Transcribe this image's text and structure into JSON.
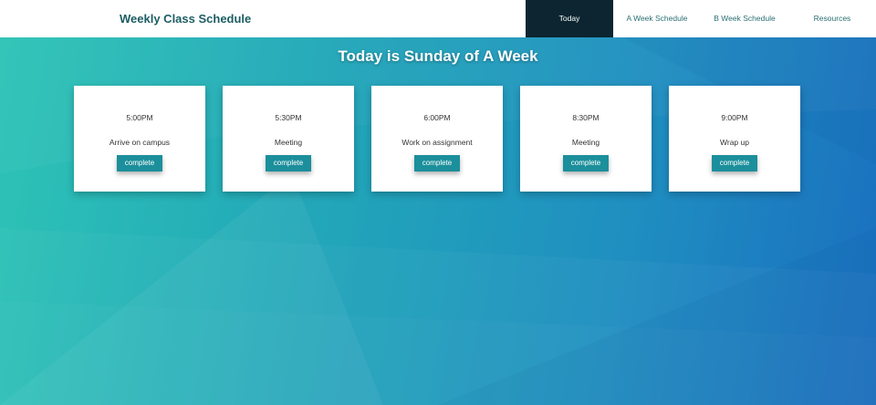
{
  "app_title": "Weekly Class Schedule",
  "nav": {
    "items": [
      {
        "label": "Today",
        "active": true
      },
      {
        "label": "A Week Schedule",
        "active": false
      },
      {
        "label": "B Week Schedule",
        "active": false
      },
      {
        "label": "Resources",
        "active": false
      }
    ]
  },
  "headline": "Today is Sunday of A Week",
  "schedule": [
    {
      "time": "5:00PM",
      "task": "Arrive on campus",
      "button": "complete"
    },
    {
      "time": "5:30PM",
      "task": "Meeting",
      "button": "complete"
    },
    {
      "time": "6:00PM",
      "task": "Work on assignment",
      "button": "complete"
    },
    {
      "time": "8:30PM",
      "task": "Meeting",
      "button": "complete"
    },
    {
      "time": "9:00PM",
      "task": "Wrap up",
      "button": "complete"
    }
  ],
  "colors": {
    "navbar_bg": "#ffffff",
    "active_tab_bg": "#0c2530",
    "brand_text": "#1d5d63",
    "button_bg": "#1b8f9b",
    "gradient_start": "#2ec4b6",
    "gradient_end": "#1a6fbf"
  }
}
